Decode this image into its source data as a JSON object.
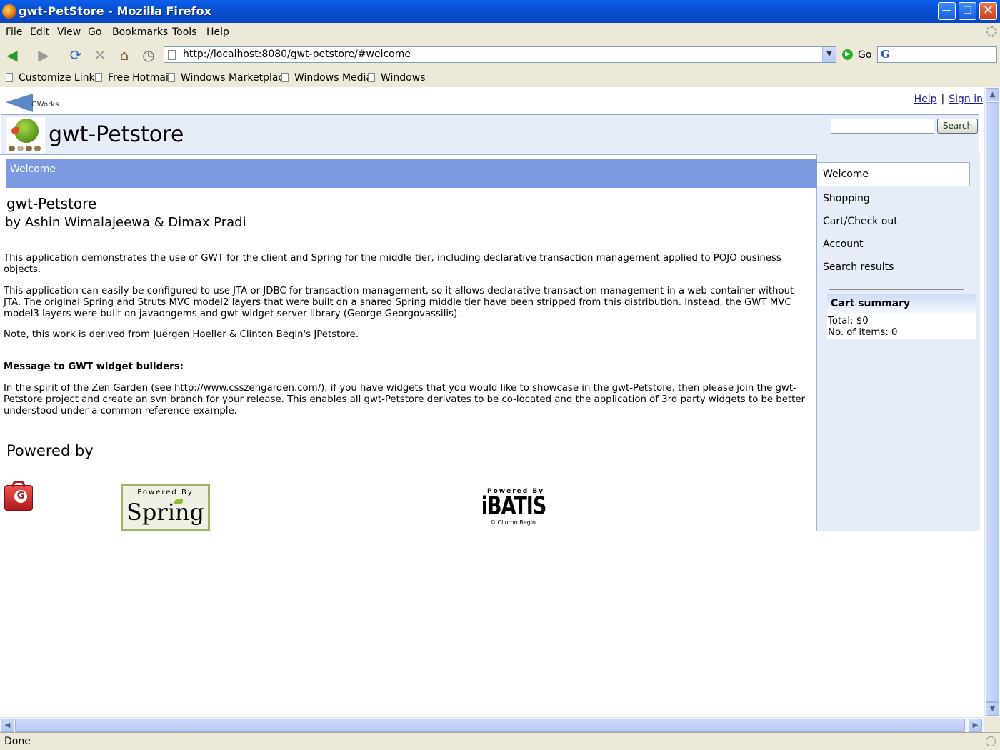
{
  "window": {
    "title": "gwt-PetStore - Mozilla Firefox",
    "min_glyph": "—",
    "max_glyph": "❐",
    "close_glyph": "✕"
  },
  "menu": {
    "items": [
      "File",
      "Edit",
      "View",
      "Go",
      "Bookmarks",
      "Tools",
      "Help"
    ]
  },
  "toolbar": {
    "back_glyph": "◀",
    "forward_glyph": "▶",
    "reload_glyph": "⟳",
    "stop_glyph": "✕",
    "home_glyph": "⌂",
    "history_glyph": "◷",
    "url": "http://localhost:8080/gwt-petstore/#welcome",
    "url_dropdown_glyph": "▼",
    "go_glyph": "▶",
    "go_label": "Go",
    "search_engine_glyph": "G"
  },
  "bookmarks": [
    "Customize Links",
    "Free Hotmail",
    "Windows Marketplace",
    "Windows Media",
    "Windows"
  ],
  "page": {
    "gworks_logo": "GWorks",
    "links": {
      "help": "Help",
      "sep": "|",
      "sign_in": "Sign in"
    },
    "site_title": "gwt-Petstore",
    "search": {
      "value": "",
      "button_label": "Search"
    },
    "welcome_tab": "Welcome",
    "heading": "gwt-Petstore",
    "authors": "by Ashin Wimalajeewa & Dimax Pradi",
    "paragraphs": [
      "This application demonstrates the use of GWT for the client and Spring for the middle tier, including declarative transaction management applied to POJO business objects.",
      "This application can easily be configured to use JTA or JDBC for transaction management, so it allows declarative transaction management in a web container without JTA. The original Spring and Struts MVC model2 layers that were built on a shared Spring middle tier have been stripped from this distribution. Instead, the GWT MVC model3 layers were built on javaongems and gwt-widget server library (George Georgovassilis).",
      "Note, this work is derived from Juergen Hoeller & Clinton Begin's JPetstore."
    ],
    "message_heading": "Message to GWT widget builders:",
    "message_body": "In the spirit of the Zen Garden (see http://www.csszengarden.com/), if you have widgets that you would like to showcase in the gwt-Petstore, then please join the gwt-Petstore project and create an svn branch for your release. This enables all gwt-Petstore derivates to be co-located and the application of 3rd party widgets to be better understood under a common reference example.",
    "powered_by": "Powered by",
    "logos": {
      "gwt": "G",
      "spring_powered": "Powered By",
      "spring_name": "Spring",
      "ibatis_powered": "Powered By",
      "ibatis_name": "iBATIS",
      "ibatis_copy": "© Clinton Begin"
    },
    "sidebar": {
      "items": [
        "Welcome",
        "Shopping",
        "Cart/Check out",
        "Account",
        "Search results"
      ],
      "active": "Welcome"
    },
    "cart": {
      "title": "Cart summary",
      "total": "Total: $0",
      "items": "No. of items: 0"
    }
  },
  "status": {
    "text": "Done"
  },
  "colors": {
    "titlebar": "#0850d0",
    "welcome_bar": "#7b9adf",
    "header_band": "#e6edf8",
    "link": "#1a1aaa"
  }
}
